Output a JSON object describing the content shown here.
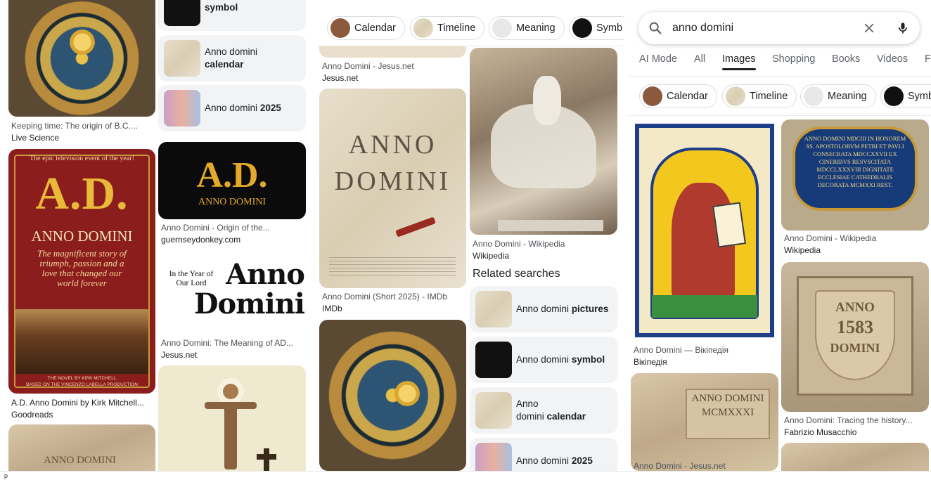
{
  "panel1": {
    "items": [
      {
        "caption": "Keeping time: The origin of B.C....",
        "source": "Live Science"
      },
      {
        "caption": "A.D. Anno Domini by Kirk Mitchell...",
        "source": "Goodreads",
        "img_text": {
          "banner": "The epic television event of the year!",
          "title": "A.D.",
          "subtitle": "ANNO DOMINI",
          "tagline": "The magnificent story of triumph, passion and a love that changed our world forever",
          "footer1": "THE NOVEL BY KIRK MITCHELL",
          "footer2": "BASED ON THE VINCENZO LABELLA PRODUCTION"
        }
      },
      {
        "img_text": "ANNO DOMINI MCMXXXI"
      }
    ],
    "related": [
      {
        "pre": "",
        "bold": "symbol"
      },
      {
        "pre": "Anno domini ",
        "bold": "calendar"
      },
      {
        "pre": "Anno domini ",
        "bold": "2025"
      }
    ],
    "cards": [
      {
        "caption": "Anno Domini - Origin of the...",
        "source": "guernseydonkey.com",
        "img_title": "A.D.",
        "img_sub": "ANNO DOMINI"
      },
      {
        "caption": "Anno Domini: The Meaning of AD...",
        "source": "Jesus.net",
        "img_small": "In the Year of Our Lord",
        "img_big": "Anno Domini"
      }
    ]
  },
  "panel2": {
    "chips": [
      "Calendar",
      "Timeline",
      "Meaning",
      "Symb"
    ],
    "items": [
      {
        "caption": "Anno Domini - Jesus.net",
        "source": "Jesus.net"
      },
      {
        "caption": "Anno Domini (Short 2025) - IMDb",
        "source": "IMDb",
        "img_line1": "ANNO",
        "img_line2": "DOMINI"
      },
      {
        "caption": "Anno Domini - Wikipedia",
        "source": "Wikipedia"
      }
    ],
    "related_heading": "Related searches",
    "related": [
      {
        "pre": "Anno domini ",
        "bold": "pictures"
      },
      {
        "pre": "Anno domini ",
        "bold": "symbol"
      },
      {
        "pre": "Anno",
        "line2_pre": "domini ",
        "bold": "calendar"
      },
      {
        "pre": "Anno domini ",
        "bold": "2025"
      }
    ]
  },
  "panel3": {
    "search": {
      "value": "anno domini"
    },
    "tabs": [
      "AI Mode",
      "All",
      "Images",
      "Shopping",
      "Books",
      "Videos",
      "F"
    ],
    "active_tab": "Images",
    "chips": [
      "Calendar",
      "Timeline",
      "Meaning",
      "Symb"
    ],
    "items": [
      {
        "caption": "Anno Domini — Вікіпедія",
        "source": "Вікіпедія"
      },
      {
        "caption": "Anno Domini - Wikipedia",
        "source": "Wikipedia",
        "img_text": "ANNO DOMINI MDCIII IN HONOREM SS. APOSTOLORVM PETRI ET PAVLI CONSECRATA MDCCXXVII EX CINERIBVS RESVSCITATA MDCCLXXXVIII DIGNITATE ECCLESIAE CATHEDRALIS DECORATA MCMXXI REST."
      },
      {
        "caption": "Anno Domini: Tracing the history...",
        "source": "Fabrizio Musacchio",
        "img_line1": "ANNO",
        "img_line2": "1583",
        "img_line3": "DOMINI"
      },
      {
        "caption": "Anno Domini - Jesus.net",
        "img_line1": "ANNO DOMINI",
        "img_line2": "MCMXXXI"
      }
    ]
  },
  "footer": {
    "letter": "p"
  },
  "colors": {
    "accent": "#202124",
    "chip_border": "#dadce0",
    "related_bg": "#f1f3f4",
    "cover_red": "#8b1d1d",
    "cover_gold": "#e9b93a"
  },
  "icons": [
    "search-icon",
    "clear-icon",
    "mic-icon"
  ]
}
